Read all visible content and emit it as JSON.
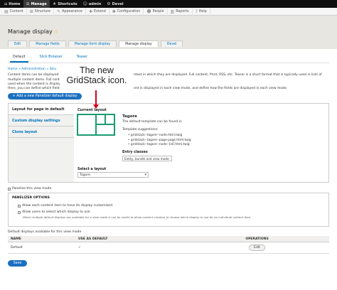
{
  "toolbar": {
    "items": [
      {
        "icon": "home-icon",
        "glyph": "⌂",
        "label": "Home"
      },
      {
        "icon": "menu-icon",
        "glyph": "≡",
        "label": "Manage"
      },
      {
        "icon": "star-icon",
        "glyph": "★",
        "label": "Shortcuts"
      },
      {
        "icon": "user-icon",
        "glyph": "☺",
        "label": "admin"
      },
      {
        "icon": "devel-icon",
        "glyph": "⚙",
        "label": "Devel"
      }
    ]
  },
  "tray": {
    "items": [
      {
        "icon": "content-icon",
        "glyph": "▤",
        "label": "Content"
      },
      {
        "icon": "structure-icon",
        "glyph": "⊞",
        "label": "Structure"
      },
      {
        "icon": "appearance-icon",
        "glyph": "✎",
        "label": "Appearance"
      },
      {
        "icon": "extend-icon",
        "glyph": "✚",
        "label": "Extend"
      },
      {
        "icon": "configuration-icon",
        "glyph": "✱",
        "label": "Configuration"
      },
      {
        "icon": "people-icon",
        "glyph": "☻",
        "label": "People"
      },
      {
        "icon": "reports-icon",
        "glyph": "▥",
        "label": "Reports"
      },
      {
        "icon": "help-icon",
        "glyph": "?",
        "label": "Help"
      }
    ]
  },
  "page": {
    "title": "Manage display",
    "primary_tabs": [
      "Edit",
      "Manage fields",
      "Manage form display",
      "Manage display",
      "Devel"
    ],
    "secondary_tabs": [
      "Default",
      "Slick Browser",
      "Teaser"
    ],
    "breadcrumb": "Home » Administration » Stru",
    "help_line1": "Content items can be displayed using different attributes depending on the context in which they are displayed. Full content, Print, RSS, etc. Teaser is a short format that is typically used in lists of multiple content items. Full content is typically",
    "help_line2": "used when the content is displayed on its own page.",
    "help_line3": "Here, you can define which fields are shown and hidden when Basic page content is displayed in each view mode, and define how the fields are displayed in each view mode."
  },
  "callout": {
    "line1": "The new",
    "line2": "GridStack icon."
  },
  "panelizer": {
    "add_button": "+ Add a new Panelizer default display",
    "vtabs": [
      "Layout for page in default",
      "Custom display settings",
      "Clone layout"
    ],
    "current_layout_label": "Current layout",
    "layout_name": "Tagore",
    "layout_desc": "The default template can be found in",
    "template_suggestions_label": "Template suggestions:",
    "templates": [
      "gridstack--tagore--node.html.twig",
      "gridstack--tagore--page-page.html.twig",
      "gridstack--tagore--node--[id].html.twig"
    ],
    "entry_classes_label": "Entry classes",
    "entry_classes_value": "Entity, bundle and view mode",
    "select_layout_label": "Select a layout",
    "select_layout_value": "Tagore",
    "panelize_label": "Panelize this view mode",
    "options_title": "PANELIZER OPTIONS",
    "option1": "Allow each content item to have its display customized",
    "option2": "Allow users to select which display to use",
    "option2_desc": "When multiple default displays are available for a view mode it can be useful to allow content creators to choose which display to use for an individual content item.",
    "defaults_label": "Default displays available for this view mode"
  },
  "table": {
    "headers": [
      "NAME",
      "USE AS DEFAULT",
      "OPERATIONS"
    ],
    "rows": [
      {
        "name": "Default",
        "default_mark": "✓",
        "operation": "Edit"
      }
    ]
  },
  "save_label": "Save",
  "colors": {
    "accent": "#1b6fc0",
    "gridstack": "#1b9b73",
    "arrow": "#d0021b"
  }
}
